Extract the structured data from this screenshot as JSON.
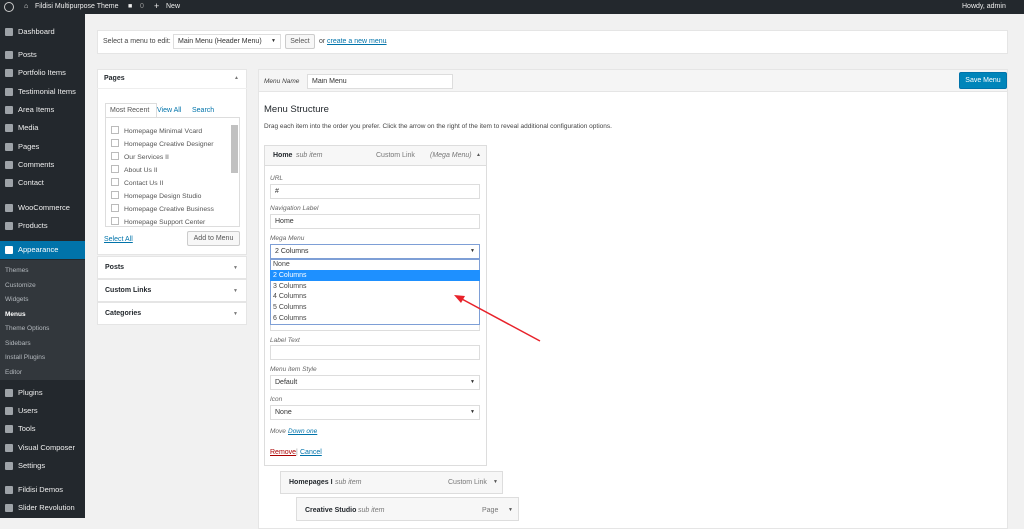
{
  "admin_bar": {
    "site_name": "Fildisi Multipurpose Theme",
    "comments_count": "0",
    "new_label": "New",
    "greeting": "Howdy, admin"
  },
  "sidebar": {
    "items": [
      {
        "label": "Dashboard",
        "icon": "dashboard-icon"
      },
      {
        "label": "Posts",
        "icon": "pin-icon"
      },
      {
        "label": "Portfolio Items",
        "icon": "portfolio-icon"
      },
      {
        "label": "Testimonial Items",
        "icon": "testimonial-icon"
      },
      {
        "label": "Area Items",
        "icon": "document-icon"
      },
      {
        "label": "Media",
        "icon": "media-icon"
      },
      {
        "label": "Pages",
        "icon": "pages-icon"
      },
      {
        "label": "Comments",
        "icon": "comment-icon"
      },
      {
        "label": "Contact",
        "icon": "mail-icon"
      },
      {
        "label": "WooCommerce",
        "icon": "woo-icon"
      },
      {
        "label": "Products",
        "icon": "box-icon"
      },
      {
        "label": "Appearance",
        "icon": "brush-icon"
      },
      {
        "label": "Plugins",
        "icon": "plugin-icon"
      },
      {
        "label": "Users",
        "icon": "user-icon"
      },
      {
        "label": "Tools",
        "icon": "wrench-icon"
      },
      {
        "label": "Visual Composer",
        "icon": "vc-icon"
      },
      {
        "label": "Settings",
        "icon": "settings-icon"
      },
      {
        "label": "Fildisi Demos",
        "icon": "cloud-icon"
      },
      {
        "label": "Slider Revolution",
        "icon": "refresh-icon"
      }
    ],
    "submenu": [
      "Themes",
      "Customize",
      "Widgets",
      "Menus",
      "Theme Options",
      "Sidebars",
      "Install Plugins",
      "Editor"
    ]
  },
  "menu_select": {
    "label": "Select a menu to edit:",
    "value": "Main Menu (Header Menu)",
    "button": "Select",
    "or": "or",
    "create_link": "create a new menu",
    "period": "."
  },
  "pages_panel": {
    "title": "Pages",
    "tabs": [
      "Most Recent",
      "View All",
      "Search"
    ],
    "pages": [
      "Homepage Minimal Vcard",
      "Homepage Creative Designer",
      "Our Services II",
      "About Us II",
      "Contact Us II",
      "Homepage Design Studio",
      "Homepage Creative Business",
      "Homepage Support Center"
    ],
    "select_all": "Select All",
    "add_button": "Add to Menu"
  },
  "accordions": [
    "Posts",
    "Custom Links",
    "Categories"
  ],
  "editor": {
    "menu_name_label": "Menu Name",
    "menu_name": "Main Menu",
    "save_button": "Save Menu",
    "structure_title": "Menu Structure",
    "instructions": "Drag each item into the order you prefer. Click the arrow on the right of the item to reveal additional configuration options."
  },
  "home_item": {
    "title": "Home",
    "subtitle": "sub item",
    "type": "Custom Link",
    "extra": "(Mega Menu)",
    "url_label": "URL",
    "url": "#",
    "nav_label_label": "Navigation Label",
    "nav_label": "Home",
    "mega_label": "Mega Menu",
    "mega_value": "2 Columns",
    "mega_options": [
      "None",
      "2 Columns",
      "3 Columns",
      "4 Columns",
      "5 Columns",
      "6 Columns"
    ],
    "label_text_label": "Label Text",
    "label_text": "",
    "style_label": "Menu item Style",
    "style": "Default",
    "icon_label": "Icon",
    "icon": "None",
    "move_label": "Move",
    "move_link": "Down one",
    "remove": "Remove",
    "sep": "|",
    "cancel": "Cancel"
  },
  "other_items": [
    {
      "title": "Homepages I",
      "subtitle": "sub item",
      "type": "Custom Link"
    },
    {
      "title": "Creative Studio",
      "subtitle": "sub item",
      "type": "Page"
    }
  ],
  "colors": {
    "accent": "#0073aa",
    "highlight": "#1e90ff",
    "arrow": "#e8222a"
  }
}
